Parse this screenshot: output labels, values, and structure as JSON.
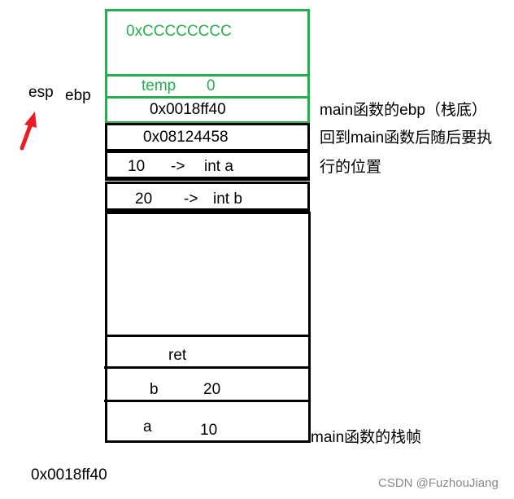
{
  "diagram": {
    "title": "main function stack frame layout",
    "colors": {
      "current_frame": "#22b14c",
      "stack_line": "#000000",
      "arrow": "#ed1c24",
      "watermark": "#8a8a8a"
    },
    "registers": {
      "esp_label": "esp",
      "ebp_label": "ebp",
      "arrow_icon": "red-arrow-up-right"
    },
    "frame_cells": {
      "fill_pattern": "0xCCCCCCCC",
      "temp_name": "temp",
      "temp_value": "0",
      "saved_ebp": "0x0018ff40"
    },
    "stack_cells": {
      "return_address": "0x08124458",
      "arg_a_value": "10",
      "arg_a_arrow": "->",
      "arg_a_name": "int a",
      "arg_b_value": "20",
      "arg_b_arrow": "->",
      "arg_b_name": "int b"
    },
    "main_frame": {
      "ret_label": "ret",
      "b_name": "b",
      "b_value": "20",
      "a_name": "a",
      "a_value": "10"
    },
    "annotations": {
      "saved_ebp_note": "main函数的ebp（栈底）",
      "return_note_line1": "回到main函数后随后要执",
      "return_note_line2": "行的位置",
      "main_frame_note": "main函数的栈帧"
    },
    "bottom_address": "0x0018ff40",
    "watermark": "CSDN @FuzhouJiang"
  }
}
